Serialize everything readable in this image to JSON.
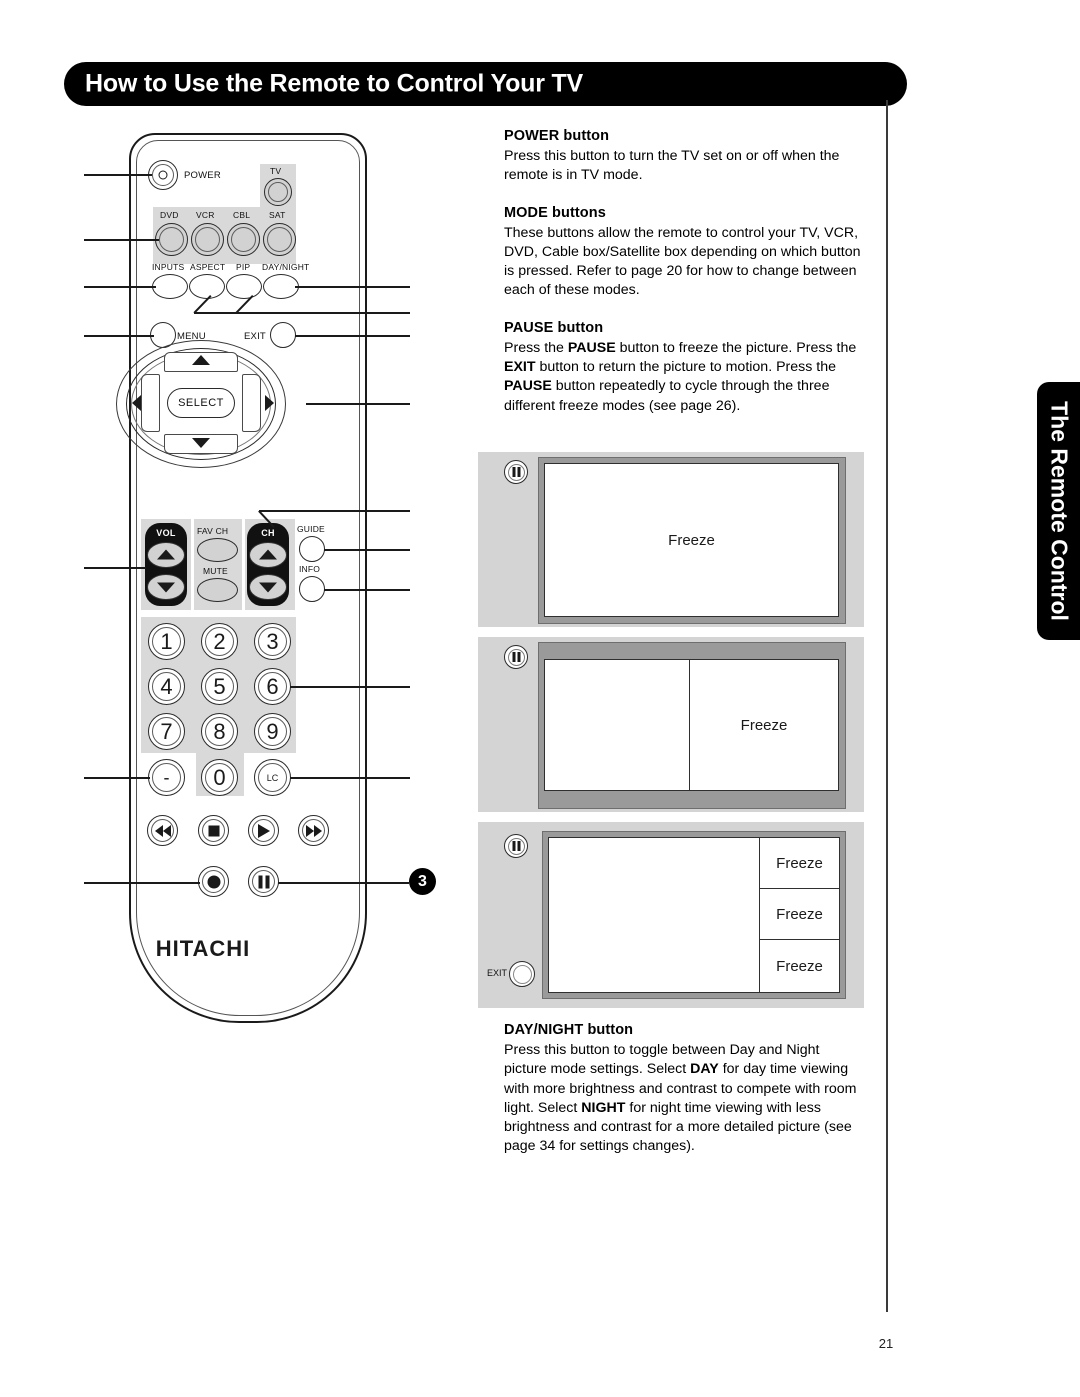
{
  "header": {
    "title": "How to Use the Remote to Control Your TV"
  },
  "side_tab": {
    "label": "The Remote Control"
  },
  "page": {
    "number": "21"
  },
  "remote": {
    "brand": "HITACHI",
    "callout_number": "3",
    "buttons": {
      "power": "POWER",
      "tv": "TV",
      "dvd": "DVD",
      "vcr": "VCR",
      "cbl": "CBL",
      "sat": "SAT",
      "inputs": "INPUTS",
      "aspect": "ASPECT",
      "pip": "PIP",
      "day_night": "DAY/NIGHT",
      "menu": "MENU",
      "exit": "EXIT",
      "select": "SELECT",
      "vol": "VOL",
      "fav_ch": "FAV CH",
      "ch": "CH",
      "guide": "GUIDE",
      "mute": "MUTE",
      "info": "INFO",
      "lc": "LC",
      "dash": "-"
    },
    "keypad": [
      "1",
      "2",
      "3",
      "4",
      "5",
      "6",
      "7",
      "8",
      "9",
      "0"
    ]
  },
  "sections": [
    {
      "heading": "POWER button",
      "body": "Press this button to turn the TV set on or off when the remote is in TV mode."
    },
    {
      "heading": "MODE buttons",
      "body": "These buttons allow the remote to control your TV, VCR, DVD, Cable box/Satellite box depending on which button is pressed.  Refer to page 20 for how to change between each of these modes."
    },
    {
      "heading": "PAUSE button",
      "body_parts": [
        {
          "t": "Press the ",
          "b": false
        },
        {
          "t": "PAUSE",
          "b": true
        },
        {
          "t": " button to freeze the picture. Press the ",
          "b": false
        },
        {
          "t": "EXIT",
          "b": true
        },
        {
          "t": " button to return the picture to motion. Press the ",
          "b": false
        },
        {
          "t": "PAUSE",
          "b": true
        },
        {
          "t": " button repeatedly to cycle through the three different freeze modes (see page 26).",
          "b": false
        }
      ]
    },
    {
      "heading": "DAY/NIGHT button",
      "body_parts": [
        {
          "t": "Press this button to toggle between Day and Night picture mode settings. Select ",
          "b": false
        },
        {
          "t": "DAY",
          "b": true
        },
        {
          "t": " for day time viewing with more brightness and contrast to compete with room light. Select ",
          "b": false
        },
        {
          "t": "NIGHT",
          "b": true
        },
        {
          "t": " for night time viewing with less brightness and contrast for a more detailed picture (see page 34 for settings changes).",
          "b": false
        }
      ]
    }
  ],
  "freeze_diagrams": [
    {
      "mode": "full-screen-freeze",
      "labels": [
        "Freeze"
      ],
      "exit_label": null
    },
    {
      "mode": "split-screen-freeze",
      "labels": [
        "Freeze"
      ],
      "exit_label": null
    },
    {
      "mode": "three-panel-freeze",
      "labels": [
        "Freeze",
        "Freeze",
        "Freeze"
      ],
      "exit_label": "EXIT"
    }
  ],
  "colors": {
    "banner": "#000000",
    "panel_grey": "#d4d4d4",
    "bezel_grey": "#9a9a9a",
    "button_grey": "#d2d2d2",
    "rocker_black": "#111111"
  }
}
